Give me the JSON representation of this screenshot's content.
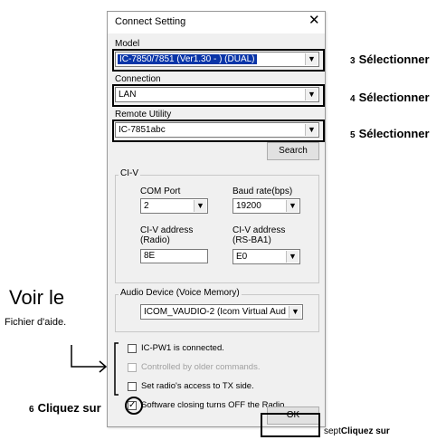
{
  "dialog": {
    "title": "Connect Setting",
    "model_label": "Model",
    "model_value": "IC-7850/7851 (Ver1.30 - ) (DUAL)",
    "connection_label": "Connection",
    "connection_value": "LAN",
    "remote_label": "Remote Utility",
    "remote_value": "IC-7851abc",
    "search_label": "Search",
    "civ": {
      "group_title": "CI-V",
      "com_port_label": "COM Port",
      "com_port_value": "2",
      "baud_label": "Baud rate(bps)",
      "baud_value": "19200",
      "civ_radio_label_1": "CI-V address",
      "civ_radio_label_2": "(Radio)",
      "civ_radio_value": "8E",
      "civ_rs_label_1": "CI-V address",
      "civ_rs_label_2": "(RS-BA1)",
      "civ_rs_value": "E0"
    },
    "audio": {
      "group_title": "Audio Device (Voice Memory)",
      "device_value": "ICOM_VAUDIO-2 (Icom Virtual Aud"
    },
    "checkboxes": [
      {
        "label": "IC-PW1 is connected.",
        "checked": false,
        "enabled": true
      },
      {
        "label": "Controlled by older commands.",
        "checked": false,
        "enabled": false
      },
      {
        "label": "Set radio's access to TX side.",
        "checked": false,
        "enabled": true
      },
      {
        "label": "Software closing turns OFF the Radio.",
        "checked": true,
        "enabled": true
      }
    ],
    "ok_label": "OK"
  },
  "annotations": {
    "step3_num": "3",
    "step3_text": "Sélectionner",
    "step4_num": "4",
    "step4_text": "Sélectionner",
    "step5_num": "5",
    "step5_text": "Sélectionner",
    "voir_le": "Voir le",
    "fichier_aide": "Fichier d'aide.",
    "step6_num": "6",
    "step6_text": "Cliquez sur",
    "step7_num": "sept",
    "step7_text": "Cliquez sur"
  },
  "colors": {
    "selection": "#0a35a8",
    "dialog_bg": "#f0f0f0"
  }
}
